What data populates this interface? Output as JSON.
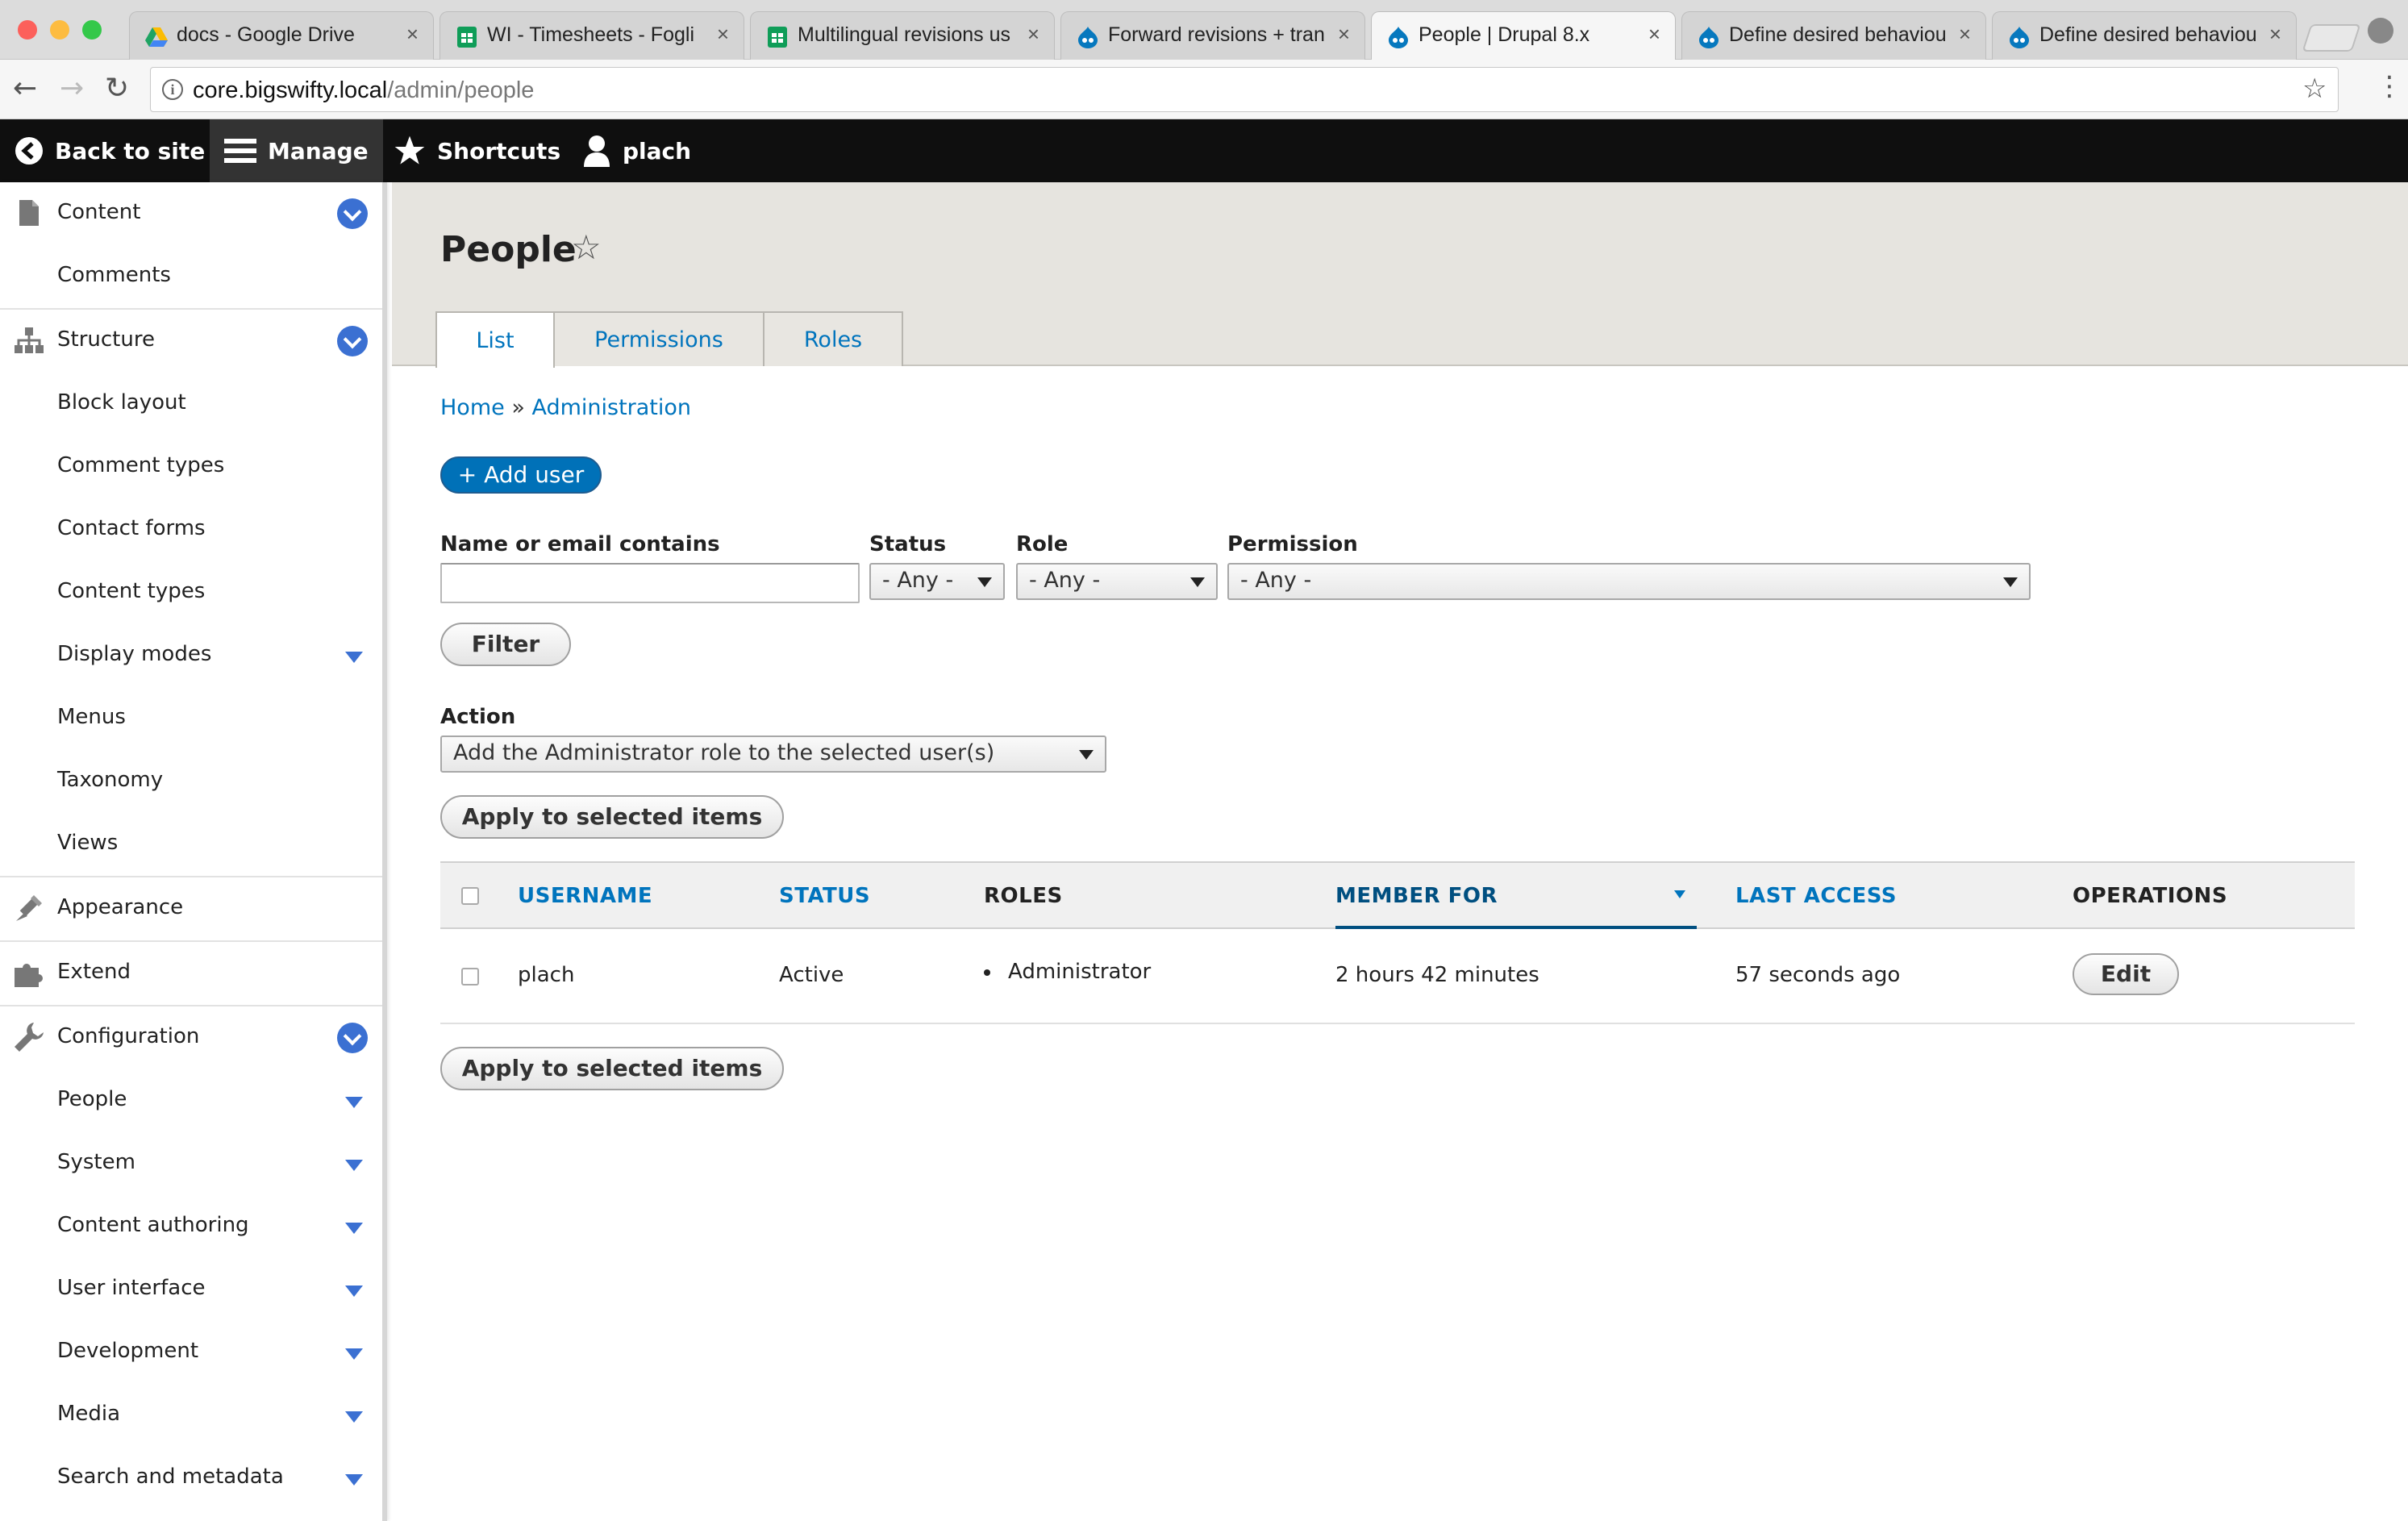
{
  "browser": {
    "tabs": [
      {
        "title": "docs - Google Drive",
        "icon": "google-drive-icon"
      },
      {
        "title": "WI - Timesheets - Fogli",
        "icon": "google-sheets-icon"
      },
      {
        "title": "Multilingual revisions us",
        "icon": "google-sheets-icon"
      },
      {
        "title": "Forward revisions + tran",
        "icon": "drupal-icon"
      },
      {
        "title": "People | Drupal 8.x",
        "icon": "drupal-icon"
      },
      {
        "title": "Define desired behaviou",
        "icon": "drupal-icon"
      },
      {
        "title": "Define desired behaviou",
        "icon": "drupal-icon"
      }
    ],
    "close_glyph": "×",
    "url_host": "core.bigswifty.local",
    "url_path": "/admin/people"
  },
  "drupal_toolbar": {
    "back": "Back to site",
    "manage": "Manage",
    "shortcuts": "Shortcuts",
    "user": "plach"
  },
  "sidebar": {
    "items": [
      {
        "label": "Content",
        "icon": "file-icon"
      },
      {
        "label": "Comments"
      },
      {
        "label": "Structure",
        "icon": "sitemap-icon"
      },
      {
        "label": "Block layout"
      },
      {
        "label": "Comment types"
      },
      {
        "label": "Contact forms"
      },
      {
        "label": "Content types"
      },
      {
        "label": "Display modes"
      },
      {
        "label": "Menus"
      },
      {
        "label": "Taxonomy"
      },
      {
        "label": "Views"
      },
      {
        "label": "Appearance",
        "icon": "paintbrush-icon"
      },
      {
        "label": "Extend",
        "icon": "puzzle-icon"
      },
      {
        "label": "Configuration",
        "icon": "wrench-icon"
      },
      {
        "label": "People"
      },
      {
        "label": "System"
      },
      {
        "label": "Content authoring"
      },
      {
        "label": "User interface"
      },
      {
        "label": "Development"
      },
      {
        "label": "Media"
      },
      {
        "label": "Search and metadata"
      }
    ]
  },
  "page": {
    "title": "People",
    "tabs": [
      "List",
      "Permissions",
      "Roles"
    ],
    "breadcrumb": {
      "home": "Home",
      "sep": "»",
      "admin": "Administration"
    },
    "add_user": "+ Add user"
  },
  "filters": {
    "name_label": "Name or email contains",
    "name_value": "",
    "status_label": "Status",
    "status_value": "- Any -",
    "role_label": "Role",
    "role_value": "- Any -",
    "permission_label": "Permission",
    "permission_value": "- Any -",
    "filter_button": "Filter"
  },
  "bulk": {
    "action_label": "Action",
    "action_value": "Add the Administrator role to the selected user(s)",
    "apply_button": "Apply to selected items"
  },
  "table": {
    "columns": [
      "USERNAME",
      "STATUS",
      "ROLES",
      "MEMBER FOR",
      "LAST ACCESS",
      "OPERATIONS"
    ],
    "rows": [
      {
        "username": "plach",
        "status": "Active",
        "role": "Administrator",
        "member_for": "2 hours 42 minutes",
        "last_access": "57 seconds ago",
        "operation": "Edit"
      }
    ]
  },
  "colors": {
    "link": "#0074bd",
    "accent": "#3b70d2",
    "toolbar_bg": "#0f0f0f",
    "header_bg": "#e6e4df"
  }
}
